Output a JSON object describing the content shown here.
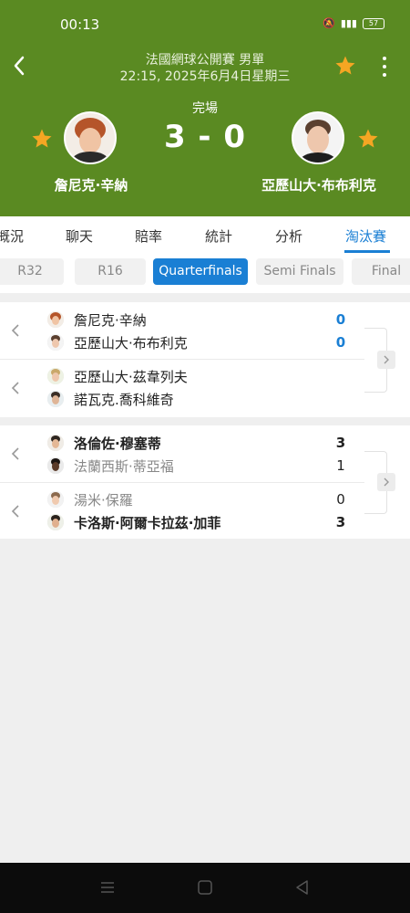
{
  "status_bar": {
    "time": "00:13",
    "battery": "57"
  },
  "header": {
    "tournament": "法國網球公開賽 男單",
    "datetime": "22:15, 2025年6月4日星期三",
    "match_status": "完場",
    "score": "3 - 0",
    "player_left": "詹尼克·辛納",
    "player_right": "亞歷山大·布布利克"
  },
  "tabs": [
    "概況",
    "聊天",
    "賠率",
    "統計",
    "分析",
    "淘汰賽"
  ],
  "active_tab": "淘汰賽",
  "rounds": [
    "R32",
    "R16",
    "Quarterfinals",
    "Semi Finals",
    "Final"
  ],
  "active_round": "Quarterfinals",
  "bracket": {
    "group1": [
      {
        "p1": "詹尼克·辛納",
        "p1_score": "0",
        "p2": "亞歷山大·布布利克",
        "p2_score": "0"
      },
      {
        "p1": "亞歷山大·茲韋列夫",
        "p1_score": "",
        "p2": "諾瓦克.喬科維奇",
        "p2_score": ""
      }
    ],
    "group2": [
      {
        "p1": "洛倫佐·穆塞蒂",
        "p1_score": "3",
        "p2": "法蘭西斯·蒂亞福",
        "p2_score": "1"
      },
      {
        "p1": "湯米·保羅",
        "p1_score": "0",
        "p2": "卡洛斯·阿爾卡拉茲·加菲",
        "p2_score": "3"
      }
    ]
  },
  "colors": {
    "header_green": "#5a8a22",
    "accent_blue": "#1a7fd4",
    "star": "#f5a623"
  }
}
